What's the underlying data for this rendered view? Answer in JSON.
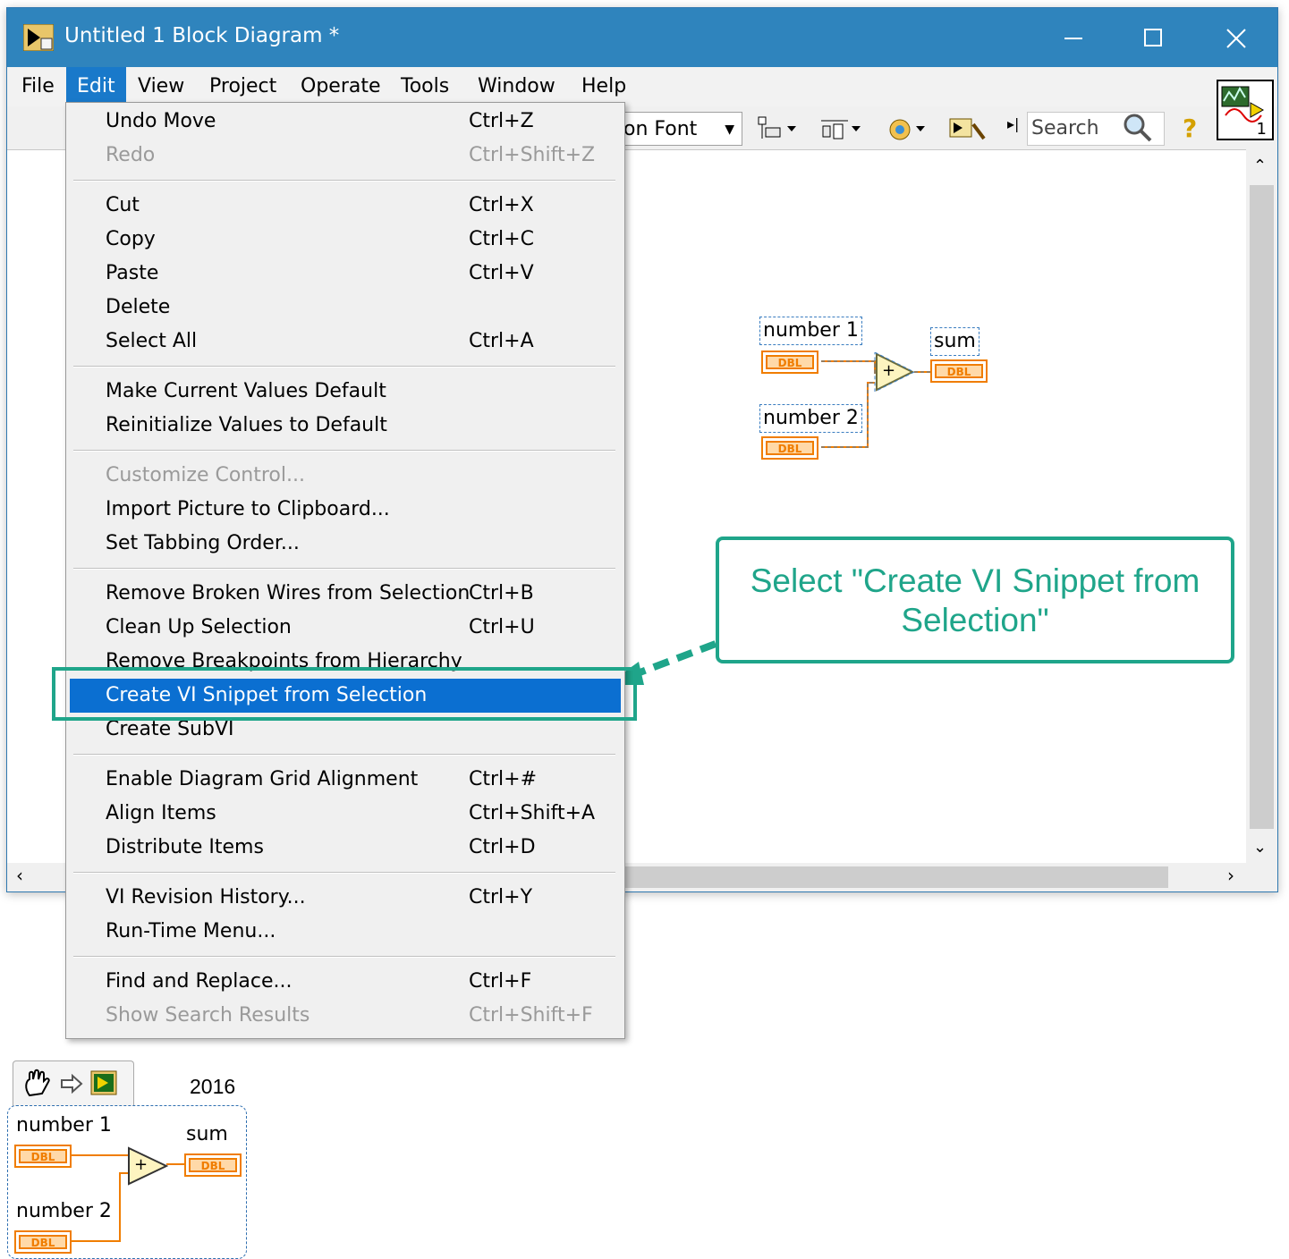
{
  "window": {
    "title": "Untitled 1 Block Diagram *",
    "controls": {
      "minimize": "—",
      "maximize": "☐",
      "close": "✕"
    }
  },
  "menubar": [
    "File",
    "Edit",
    "View",
    "Project",
    "Operate",
    "Tools",
    "Window",
    "Help"
  ],
  "toolbar": {
    "font": "on Font",
    "search_placeholder": "Search",
    "help": "?",
    "vi_icon_number": "1"
  },
  "edit_menu": [
    {
      "label": "Undo Move",
      "shortcut": "Ctrl+Z",
      "disabled": false
    },
    {
      "label": "Redo",
      "shortcut": "Ctrl+Shift+Z",
      "disabled": true
    },
    {
      "label": "Cut",
      "shortcut": "Ctrl+X",
      "disabled": false
    },
    {
      "label": "Copy",
      "shortcut": "Ctrl+C",
      "disabled": false
    },
    {
      "label": "Paste",
      "shortcut": "Ctrl+V",
      "disabled": false
    },
    {
      "label": "Delete",
      "shortcut": "",
      "disabled": false
    },
    {
      "label": "Select All",
      "shortcut": "Ctrl+A",
      "disabled": false
    },
    {
      "label": "Make Current Values Default",
      "shortcut": "",
      "disabled": false
    },
    {
      "label": "Reinitialize Values to Default",
      "shortcut": "",
      "disabled": false
    },
    {
      "label": "Customize Control...",
      "shortcut": "",
      "disabled": true
    },
    {
      "label": "Import Picture to Clipboard...",
      "shortcut": "",
      "disabled": false
    },
    {
      "label": "Set Tabbing Order...",
      "shortcut": "",
      "disabled": false
    },
    {
      "label": "Remove Broken Wires from Selection",
      "shortcut": "Ctrl+B",
      "disabled": false
    },
    {
      "label": "Clean Up Selection",
      "shortcut": "Ctrl+U",
      "disabled": false
    },
    {
      "label": "Remove Breakpoints from Hierarchy",
      "shortcut": "",
      "disabled": false
    },
    {
      "label": "Create VI Snippet from Selection",
      "shortcut": "",
      "disabled": false
    },
    {
      "label": "Create SubVI",
      "shortcut": "",
      "disabled": false
    },
    {
      "label": "Enable Diagram Grid Alignment",
      "shortcut": "Ctrl+#",
      "disabled": false
    },
    {
      "label": "Align Items",
      "shortcut": "Ctrl+Shift+A",
      "disabled": false
    },
    {
      "label": "Distribute Items",
      "shortcut": "Ctrl+D",
      "disabled": false
    },
    {
      "label": "VI Revision History...",
      "shortcut": "Ctrl+Y",
      "disabled": false
    },
    {
      "label": "Run-Time Menu...",
      "shortcut": "",
      "disabled": false
    },
    {
      "label": "Find and Replace...",
      "shortcut": "Ctrl+F",
      "disabled": false
    },
    {
      "label": "Show Search Results",
      "shortcut": "Ctrl+Shift+F",
      "disabled": true
    }
  ],
  "diagram": {
    "number1": "number 1",
    "number2": "number 2",
    "sum": "sum",
    "dbl": "DBL",
    "add_op": "+"
  },
  "callout": {
    "line1": "Select \"Create VI Snippet from",
    "line2": "Selection\""
  },
  "snippet": {
    "year": "2016",
    "number1": "number 1",
    "number2": "number 2",
    "sum": "sum",
    "dbl": "DBL",
    "add_op": "+"
  },
  "colors": {
    "titlebar": "#2f84bd",
    "menu_highlight": "#0b6fd1",
    "callout_accent": "#1fa58a",
    "dbl_orange": "#f07d00"
  }
}
